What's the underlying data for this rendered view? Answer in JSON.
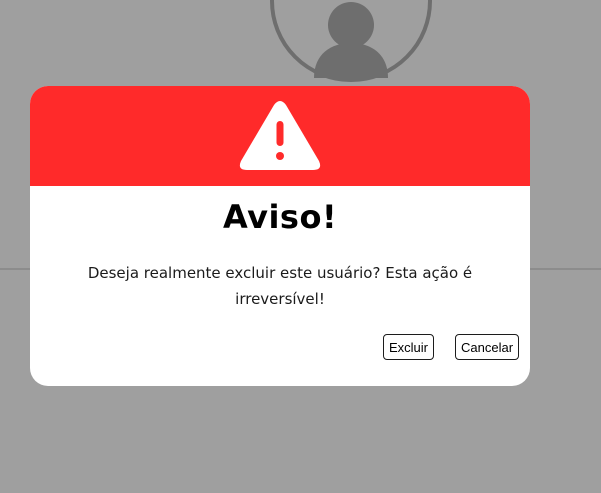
{
  "background": {
    "avatar_icon": "user-avatar-icon",
    "color": "#9f9f9f"
  },
  "modal": {
    "header_color": "#ff2a2a",
    "warning_icon": "warning-triangle-icon",
    "title": "Aviso!",
    "message": "Deseja realmente excluir este usuário? Esta ação é irreversível!",
    "buttons": {
      "delete_label": "Excluir",
      "cancel_label": "Cancelar"
    }
  }
}
